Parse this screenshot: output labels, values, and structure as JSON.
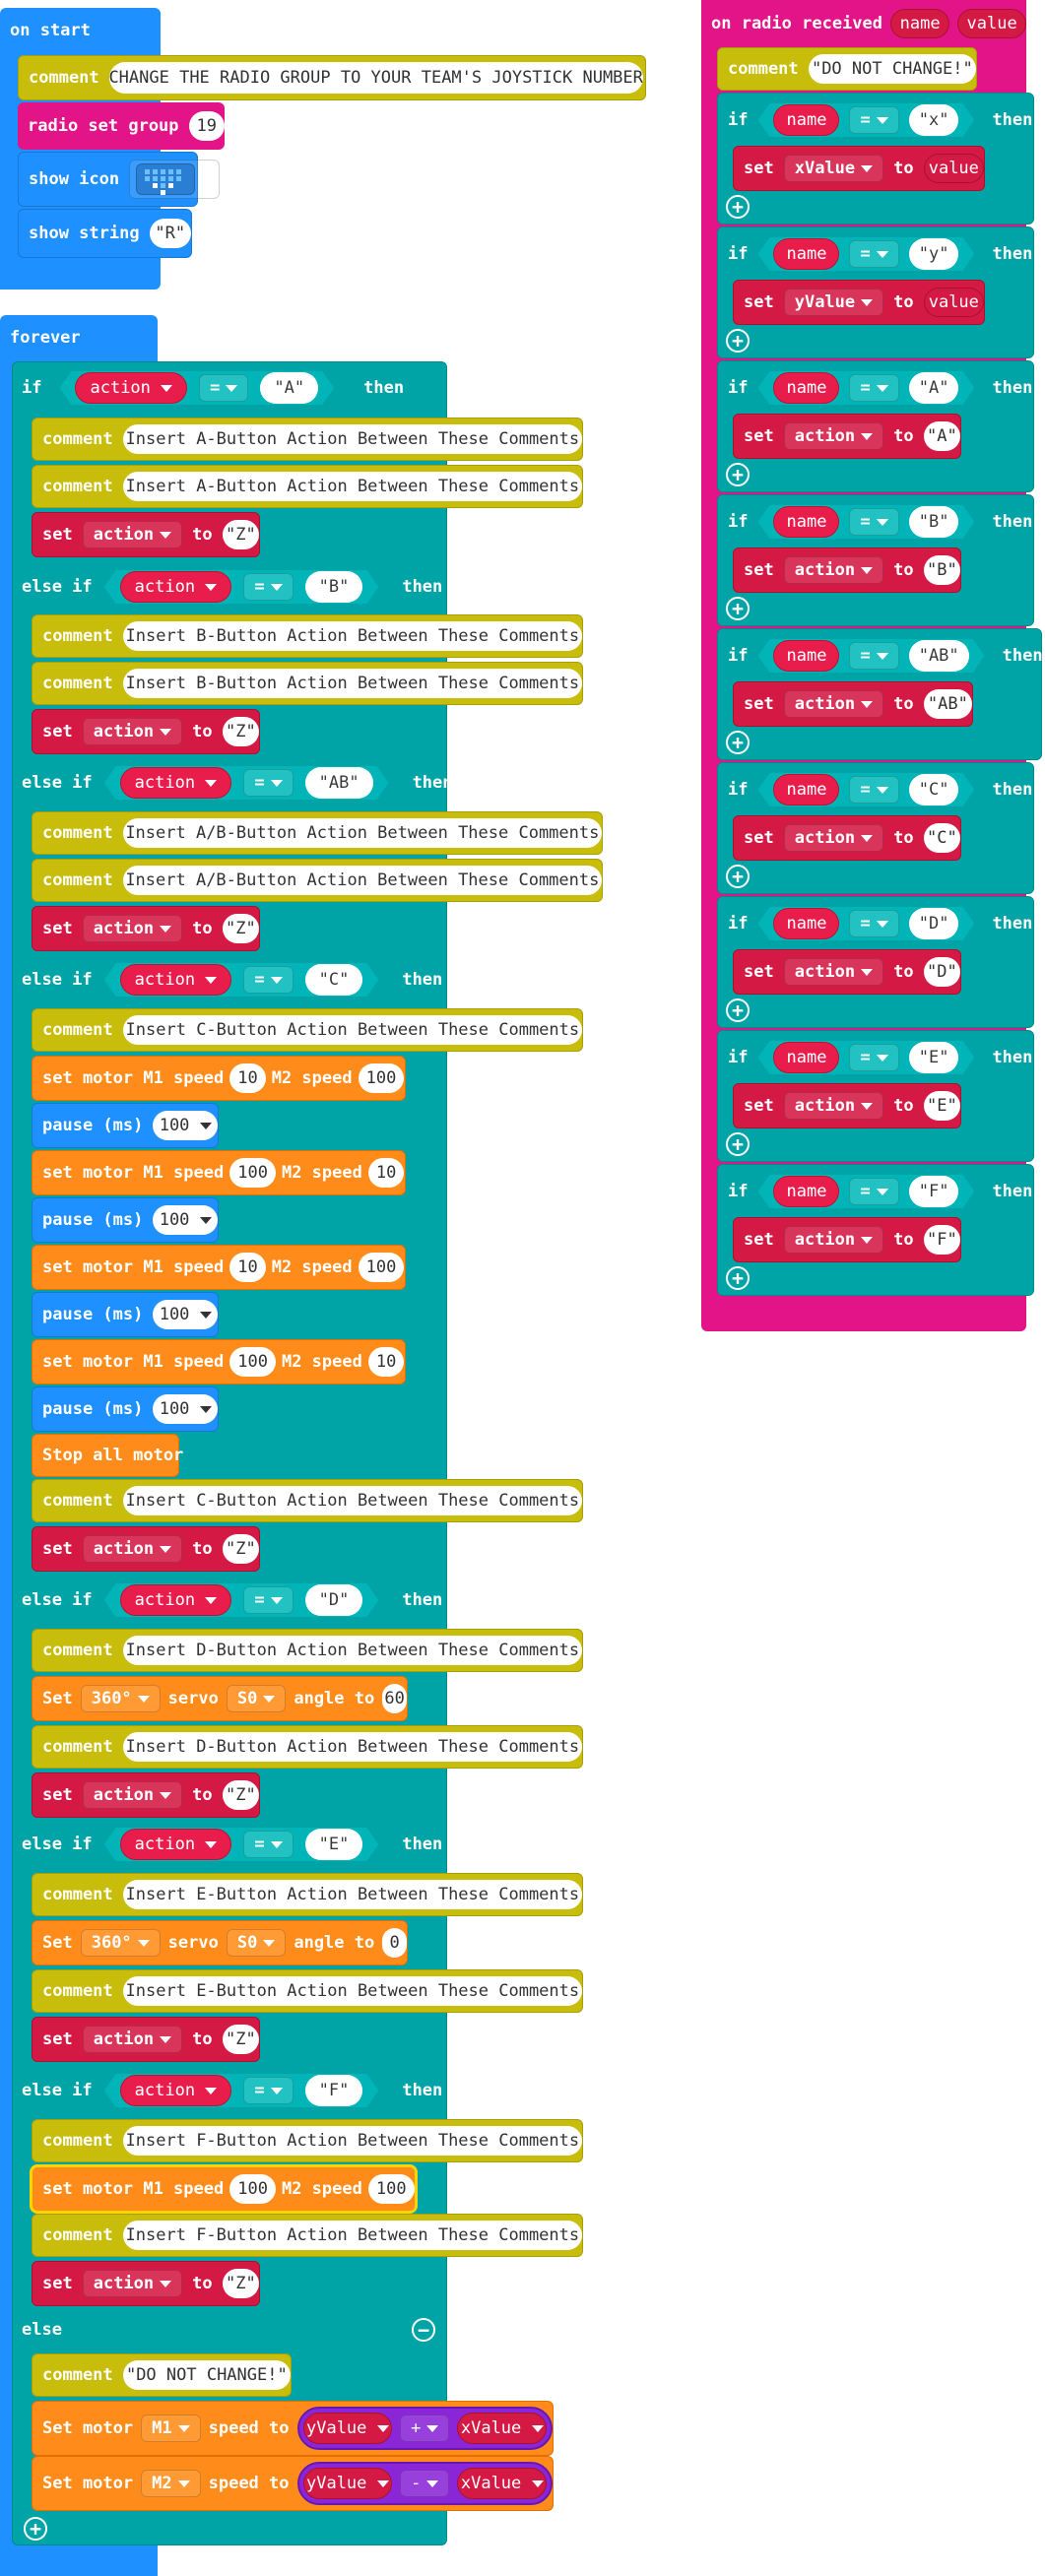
{
  "on_start": {
    "title": "on start",
    "comment": "CHANGE THE RADIO GROUP TO YOUR TEAM'S JOYSTICK NUMBER",
    "radio_set_group": "radio set group",
    "group_value": "19",
    "show_icon": "show icon",
    "show_string": "show string",
    "string_value": "R"
  },
  "forever": {
    "title": "forever",
    "kw_if": "if",
    "kw_else_if": "else if",
    "kw_else": "else",
    "kw_then": "then",
    "kw_set": "set",
    "kw_to": "to",
    "kw_comment": "comment",
    "var_action": "action",
    "op_eq": "=",
    "z": "Z",
    "A": {
      "value": "A",
      "comment": "Insert A-Button Action Between These Comments"
    },
    "B": {
      "value": "B",
      "comment": "Insert B-Button Action Between These Comments"
    },
    "AB": {
      "value": "AB",
      "comment": "Insert A/B-Button Action Between These Comments"
    },
    "C": {
      "value": "C",
      "comment": "Insert C-Button Action Between These Comments"
    },
    "D": {
      "value": "D",
      "comment": "Insert D-Button Action Between These Comments"
    },
    "E": {
      "value": "E",
      "comment": "Insert E-Button Action Between These Comments"
    },
    "F": {
      "value": "F",
      "comment": "Insert F-Button Action Between These Comments"
    },
    "motor": {
      "set_motor_m1": "set motor M1 speed",
      "m2_speed": "M2 speed",
      "v10": "10",
      "v100": "100"
    },
    "pause": {
      "label": "pause (ms)",
      "value": "100"
    },
    "stop_all": "Stop all motor",
    "servo": {
      "set": "Set",
      "deg": "360°",
      "servo": "servo",
      "s0": "S0",
      "angle_to": "angle to",
      "d_angle": "60",
      "e_angle": "0"
    },
    "else_comment": "DO NOT CHANGE!",
    "set_motor": {
      "label": "Set motor",
      "m1": "M1",
      "m2": "M2",
      "speed_to": "speed to",
      "yvalue": "yValue",
      "xvalue": "xValue",
      "plus": "+",
      "minus": "-"
    }
  },
  "radio": {
    "title": "on radio received",
    "param_name": "name",
    "param_value": "value",
    "comment": "DO NOT CHANGE!",
    "kw_if": "if",
    "kw_then": "then",
    "kw_set": "set",
    "kw_to": "to",
    "kw_comment": "comment",
    "op_eq": "=",
    "var_action": "action",
    "var_value": "value",
    "cases": [
      {
        "key": "x",
        "var": "xValue",
        "val": "value"
      },
      {
        "key": "y",
        "var": "yValue",
        "val": "value"
      },
      {
        "key": "A",
        "var": "action",
        "val": "A"
      },
      {
        "key": "B",
        "var": "action",
        "val": "B"
      },
      {
        "key": "AB",
        "var": "action",
        "val": "AB"
      },
      {
        "key": "C",
        "var": "action",
        "val": "C"
      },
      {
        "key": "D",
        "var": "action",
        "val": "D"
      },
      {
        "key": "E",
        "var": "action",
        "val": "E"
      },
      {
        "key": "F",
        "var": "action",
        "val": "F"
      }
    ]
  }
}
